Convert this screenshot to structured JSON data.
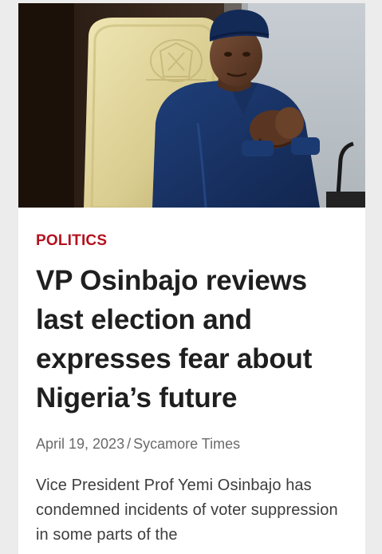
{
  "article": {
    "image_alt": "Vice President Osinbajo seated in a council chamber",
    "category": "POLITICS",
    "title": "VP Osinbajo reviews last election and expresses fear about Nigeria’s future",
    "date": "April 19, 2023",
    "separator": "/",
    "author": "Sycamore Times",
    "excerpt": "Vice President Prof Yemi Osinbajo has condemned incidents of voter suppression in some parts of the"
  },
  "colors": {
    "category": "#b3121f",
    "title": "#1f1f1f",
    "meta": "#6a6a6a",
    "body_text": "#3d3d3d",
    "page_background": "#ececec",
    "card_background": "#ffffff"
  }
}
